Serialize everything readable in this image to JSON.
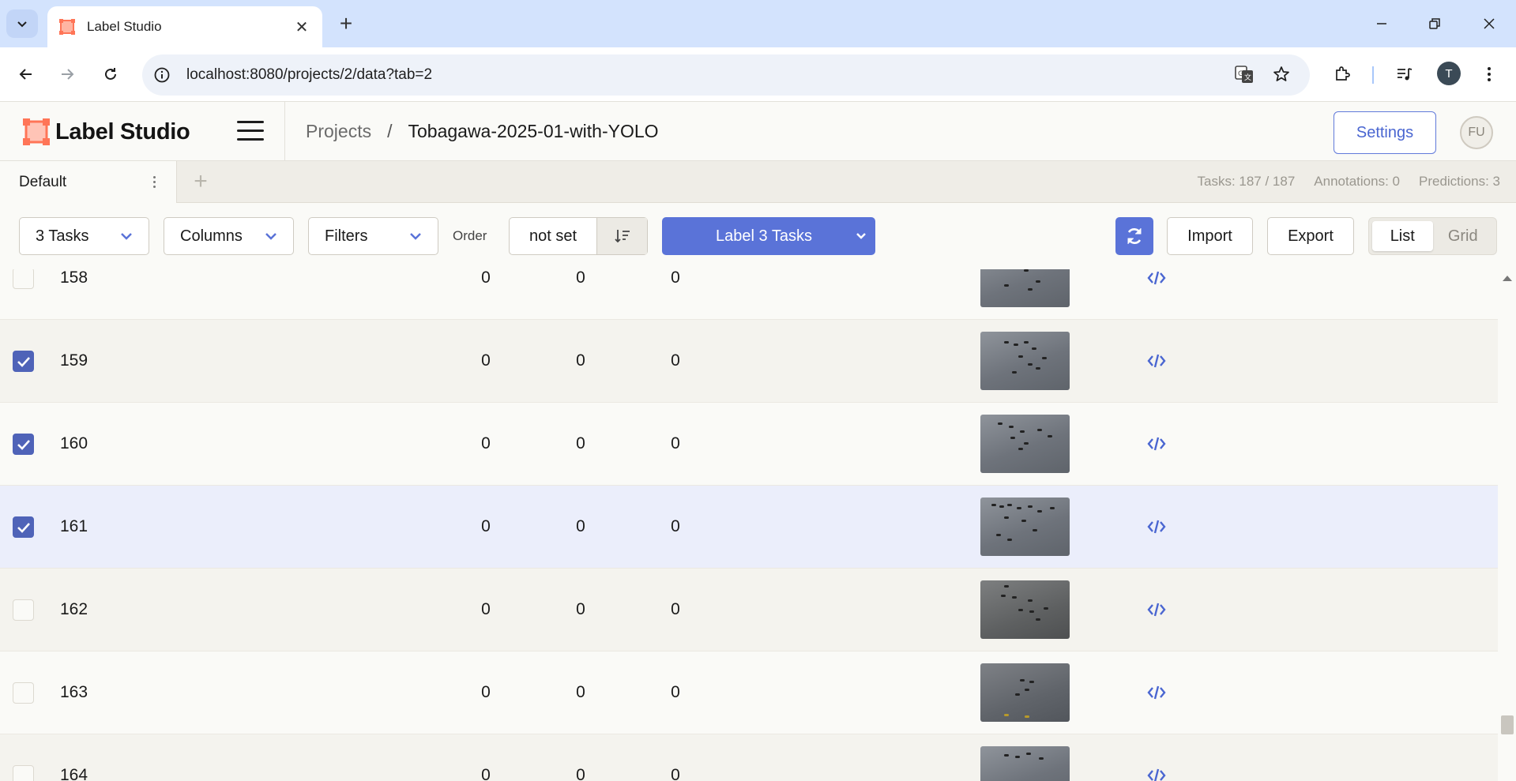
{
  "browser": {
    "tab_title": "Label Studio",
    "url": "localhost:8080/projects/2/data?tab=2",
    "profile_initial": "T"
  },
  "header": {
    "logo_text": "Label Studio",
    "breadcrumb_projects": "Projects",
    "breadcrumb_separator": "/",
    "project_name": "Tobagawa-2025-01-with-YOLO",
    "settings_label": "Settings",
    "avatar_initials": "FU"
  },
  "views": {
    "active_tab": "Default",
    "add_symbol": "+",
    "stats": {
      "tasks": "Tasks: 187 / 187",
      "annotations": "Annotations: 0",
      "predictions": "Predictions: 3"
    }
  },
  "toolbar": {
    "tasks_dropdown": "3 Tasks",
    "columns_dropdown": "Columns",
    "filters_dropdown": "Filters",
    "order_label": "Order",
    "order_value": "not set",
    "label_button": "Label 3 Tasks",
    "import_label": "Import",
    "export_label": "Export",
    "view_list": "List",
    "view_grid": "Grid"
  },
  "colors": {
    "accent": "#5a73d8",
    "checkbox_checked": "#4f63b8",
    "row_highlight": "#ebeefb",
    "logo_orange": "#ff7557"
  },
  "rows": [
    {
      "id": "158",
      "c1": "0",
      "c2": "0",
      "c3": "0",
      "checked": false
    },
    {
      "id": "159",
      "c1": "0",
      "c2": "0",
      "c3": "0",
      "checked": true
    },
    {
      "id": "160",
      "c1": "0",
      "c2": "0",
      "c3": "0",
      "checked": true
    },
    {
      "id": "161",
      "c1": "0",
      "c2": "0",
      "c3": "0",
      "checked": true
    },
    {
      "id": "162",
      "c1": "0",
      "c2": "0",
      "c3": "0",
      "checked": false
    },
    {
      "id": "163",
      "c1": "0",
      "c2": "0",
      "c3": "0",
      "checked": false
    },
    {
      "id": "164",
      "c1": "0",
      "c2": "0",
      "c3": "0",
      "checked": false
    }
  ],
  "icons": {
    "source_icon": "code-icon",
    "sort_icon": "sort-desc-icon",
    "refresh_icon": "refresh-icon"
  }
}
